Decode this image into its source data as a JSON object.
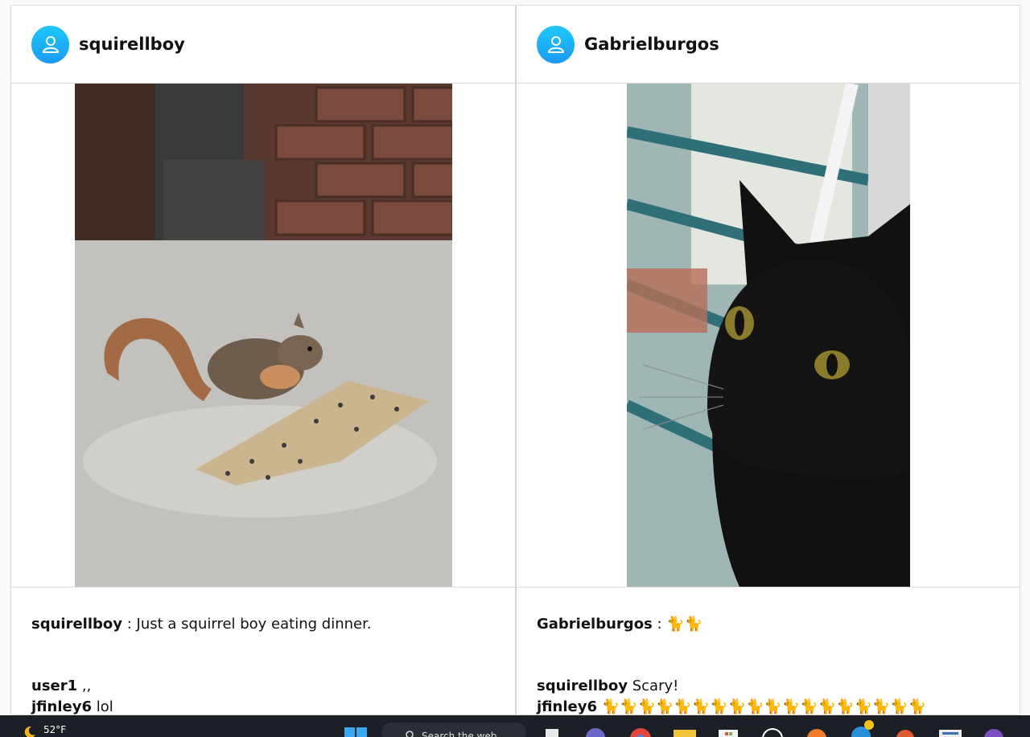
{
  "posts": [
    {
      "username": "squirellboy",
      "caption_user": "squirellboy",
      "caption_sep": " : ",
      "caption_text": "Just a squirrel boy eating dinner.",
      "comments": [
        {
          "user": "user1",
          "text": " ,,"
        },
        {
          "user": "jfinley6",
          "text": " lol"
        }
      ]
    },
    {
      "username": "Gabrielburgos",
      "caption_user": "Gabrielburgos",
      "caption_sep": " : ",
      "caption_text": "🐈🐈",
      "comments": [
        {
          "user": "squirellboy",
          "text": " Scary!"
        },
        {
          "user": "jfinley6",
          "text": " 🐈🐈🐈🐈🐈🐈🐈🐈🐈🐈🐈🐈🐈🐈🐈🐈🐈🐈"
        }
      ]
    }
  ],
  "taskbar": {
    "weather_temp": "52°F",
    "search_placeholder": "Search the web"
  },
  "colors": {
    "avatar_gradient_top": "#1ec8f8",
    "avatar_gradient_bottom": "#1a9af5",
    "emoji_purple": "#5b3f99",
    "taskbar": "#1c1f26"
  },
  "icons": [
    "user-avatar-icon",
    "weather-icon",
    "windows-start-icon",
    "search-icon",
    "task-view-icon",
    "teams-icon",
    "chrome-icon",
    "file-explorer-icon",
    "store-icon",
    "github-icon",
    "firefox-icon",
    "edge-icon",
    "app-icon",
    "news-icon",
    "app-icon-2"
  ]
}
